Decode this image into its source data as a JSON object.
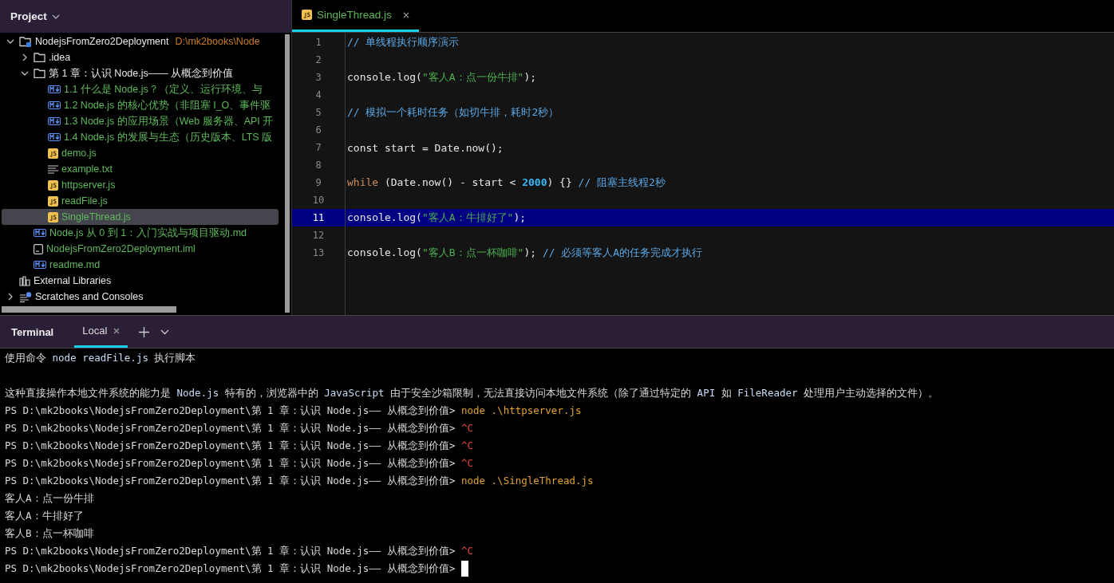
{
  "project_panel": {
    "title": "Project"
  },
  "tree": [
    {
      "kind": "project",
      "name": "NodejsFromZero2Deployment",
      "path": "D:\\mk2books\\Node",
      "expanded": true,
      "selected": false,
      "children": [
        {
          "kind": "folder",
          "name": ".idea",
          "expanded": false,
          "selected": false
        },
        {
          "kind": "folder",
          "name": "第 1 章：认识 Node.js—— 从概念到价值",
          "expanded": true,
          "selected": false,
          "children": [
            {
              "kind": "md",
              "name": "1.1 什么是 Node.js？（定义、运行环境、与",
              "selected": false
            },
            {
              "kind": "md",
              "name": "1.2 Node.js 的核心优势（非阻塞 I_O、事件驱",
              "selected": false
            },
            {
              "kind": "md",
              "name": "1.3 Node.js 的应用场景（Web 服务器、API 开",
              "selected": false
            },
            {
              "kind": "md",
              "name": "1.4 Node.js 的发展与生态（历史版本、LTS 版",
              "selected": false
            },
            {
              "kind": "js",
              "name": "demo.js",
              "selected": false
            },
            {
              "kind": "txt",
              "name": "example.txt",
              "selected": false
            },
            {
              "kind": "js",
              "name": "httpserver.js",
              "selected": false
            },
            {
              "kind": "js",
              "name": "readFile.js",
              "selected": false
            },
            {
              "kind": "js",
              "name": "SingleThread.js",
              "selected": true
            }
          ]
        },
        {
          "kind": "md",
          "name": "Node.js 从 0 到 1：入门实战与项目驱动.md",
          "selected": false
        },
        {
          "kind": "iml",
          "name": "NodejsFromZero2Deployment.iml",
          "selected": false
        },
        {
          "kind": "md",
          "name": "readme.md",
          "selected": false
        }
      ]
    },
    {
      "kind": "library",
      "name": "External Libraries",
      "selected": false
    },
    {
      "kind": "scratches",
      "name": "Scratches and Consoles",
      "expanded": false,
      "selected": false
    }
  ],
  "editor": {
    "tabs": [
      {
        "label": "SingleThread.js",
        "selected": true
      }
    ],
    "lines": [
      {
        "number": "1",
        "selected": false,
        "tokens": [
          {
            "kind": "comment",
            "text": "// 单线程执行顺序演示"
          }
        ]
      },
      {
        "number": "2",
        "selected": false
      },
      {
        "number": "3",
        "selected": false,
        "tokens": [
          {
            "kind": "plain",
            "text": "console.log("
          },
          {
            "kind": "string",
            "text": "\"客人A：点一份牛排\""
          },
          {
            "kind": "plain",
            "text": ");"
          }
        ]
      },
      {
        "number": "4",
        "selected": false
      },
      {
        "number": "5",
        "selected": false,
        "tokens": [
          {
            "kind": "comment",
            "text": "// 模拟一个耗时任务（如切牛排，耗时2秒）"
          }
        ]
      },
      {
        "number": "6",
        "selected": false
      },
      {
        "number": "7",
        "selected": false,
        "tokens": [
          {
            "kind": "plain",
            "text": "const start = Date.now();"
          }
        ]
      },
      {
        "number": "8",
        "selected": false
      },
      {
        "number": "9",
        "selected": false,
        "tokens": [
          {
            "kind": "keyword",
            "text": "while"
          },
          {
            "kind": "plain",
            "text": " (Date.now() - start < "
          },
          {
            "kind": "number",
            "text": "2000"
          },
          {
            "kind": "plain",
            "text": ") {} "
          },
          {
            "kind": "comment",
            "text": "// 阻塞主线程2秒"
          }
        ]
      },
      {
        "number": "10",
        "selected": false
      },
      {
        "number": "11",
        "selected": true,
        "tokens": [
          {
            "kind": "plain",
            "text": "console.log("
          },
          {
            "kind": "string",
            "text": "\"客人A：牛排好了\""
          },
          {
            "kind": "plain",
            "text": ");"
          }
        ]
      },
      {
        "number": "12",
        "selected": false
      },
      {
        "number": "13",
        "selected": false,
        "tokens": [
          {
            "kind": "plain",
            "text": "console.log("
          },
          {
            "kind": "string",
            "text": "\"客人B：点一杯咖啡\""
          },
          {
            "kind": "plain",
            "text": "); "
          },
          {
            "kind": "comment",
            "text": "// 必须等客人A的任务完成才执行"
          }
        ]
      }
    ]
  },
  "terminal": {
    "title": "Terminal",
    "tabs": [
      {
        "label": "Local",
        "selected": true
      }
    ],
    "cursor": true,
    "lines": [
      {
        "kind": "output",
        "segments": [
          {
            "kind": "text",
            "text": "使用命令 "
          },
          {
            "kind": "code",
            "text": "node readFile.js"
          },
          {
            "kind": "text",
            "text": " 执行脚本"
          }
        ]
      },
      {
        "kind": "blank"
      },
      {
        "kind": "output",
        "segments": [
          {
            "kind": "text",
            "text": "这种直接操作本地文件系统的能力是 "
          },
          {
            "kind": "code",
            "text": "Node.js"
          },
          {
            "kind": "text",
            "text": " 特有的，浏览器中的 "
          },
          {
            "kind": "code",
            "text": "JavaScript"
          },
          {
            "kind": "text",
            "text": " 由于安全沙箱限制，无法直接访问本地文件系统（除了通过特定的 "
          },
          {
            "kind": "code",
            "text": "API"
          },
          {
            "kind": "text",
            "text": " 如 "
          },
          {
            "kind": "code",
            "text": "FileReader"
          },
          {
            "kind": "text",
            "text": " 处理用户主动选择的文件）。"
          }
        ]
      },
      {
        "kind": "output",
        "segments": [
          {
            "kind": "text",
            "text": "PS D:\\mk2books\\NodejsFromZero2Deployment\\第 1 章：认识 Node.js—— 从概念到价值> "
          },
          {
            "kind": "command",
            "text": "node .\\httpserver.js"
          }
        ]
      },
      {
        "kind": "output",
        "segments": [
          {
            "kind": "text",
            "text": "PS D:\\mk2books\\NodejsFromZero2Deployment\\第 1 章：认识 Node.js—— 从概念到价值> "
          },
          {
            "kind": "interrupt",
            "text": "^C"
          }
        ]
      },
      {
        "kind": "output",
        "segments": [
          {
            "kind": "text",
            "text": "PS D:\\mk2books\\NodejsFromZero2Deployment\\第 1 章：认识 Node.js—— 从概念到价值> "
          },
          {
            "kind": "interrupt",
            "text": "^C"
          }
        ]
      },
      {
        "kind": "output",
        "segments": [
          {
            "kind": "text",
            "text": "PS D:\\mk2books\\NodejsFromZero2Deployment\\第 1 章：认识 Node.js—— 从概念到价值> "
          },
          {
            "kind": "interrupt",
            "text": "^C"
          }
        ]
      },
      {
        "kind": "output",
        "segments": [
          {
            "kind": "text",
            "text": "PS D:\\mk2books\\NodejsFromZero2Deployment\\第 1 章：认识 Node.js—— 从概念到价值> "
          },
          {
            "kind": "command",
            "text": "node .\\SingleThread.js"
          }
        ]
      },
      {
        "kind": "output",
        "segments": [
          {
            "kind": "text",
            "text": "客人A：点一份牛排"
          }
        ]
      },
      {
        "kind": "output",
        "segments": [
          {
            "kind": "text",
            "text": "客人A：牛排好了"
          }
        ]
      },
      {
        "kind": "output",
        "segments": [
          {
            "kind": "text",
            "text": "客人B：点一杯咖啡"
          }
        ]
      },
      {
        "kind": "output",
        "segments": [
          {
            "kind": "text",
            "text": "PS D:\\mk2books\\NodejsFromZero2Deployment\\第 1 章：认识 Node.js—— 从概念到价值> "
          },
          {
            "kind": "interrupt",
            "text": "^C"
          }
        ]
      },
      {
        "kind": "output",
        "segments": [
          {
            "kind": "text",
            "text": "PS D:\\mk2books\\NodejsFromZero2Deployment\\第 1 章：认识 Node.js—— 从概念到价值> "
          }
        ]
      }
    ]
  }
}
